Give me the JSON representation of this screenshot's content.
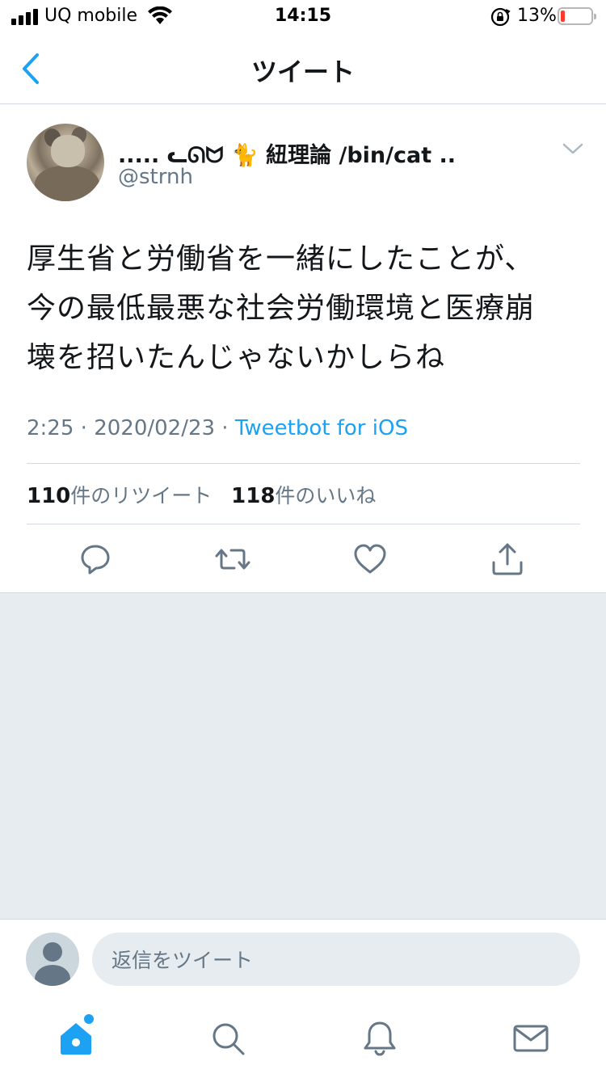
{
  "status_bar": {
    "carrier": "UQ mobile",
    "time": "14:15",
    "battery_percent": "13%",
    "battery_level": 0.13,
    "battery_color": "#ff3b30"
  },
  "nav": {
    "title": "ツイート",
    "back_icon": "chevron-left-icon"
  },
  "tweet": {
    "display_name": "..... ᓚᘏᗢ 🐈 紐理論 /bin/cat ..",
    "handle": "@strnh",
    "text_lines": [
      "厚生省と労働省を一緒にしたことが、",
      "今の最低最悪な社会労働環境と医療崩",
      "壊を招いたんじゃないかしらね"
    ],
    "time": "2:25",
    "date": "2020/02/23",
    "separator": " · ",
    "source": "Tweetbot for iOS",
    "retweet_count": "110",
    "retweet_label": "件のリツイート",
    "like_count": "118",
    "like_label": "件のいいね"
  },
  "actions": [
    "reply-icon",
    "retweet-icon",
    "like-icon",
    "share-icon"
  ],
  "reply_bar": {
    "placeholder": "返信をツイート"
  },
  "tab_bar": [
    "home-icon",
    "search-icon",
    "notifications-icon",
    "messages-icon"
  ],
  "colors": {
    "accent": "#1da1f2",
    "text_primary": "#14171a",
    "text_secondary": "#657786",
    "background_gray": "#e6ecf0",
    "divider": "#d3d9de"
  }
}
